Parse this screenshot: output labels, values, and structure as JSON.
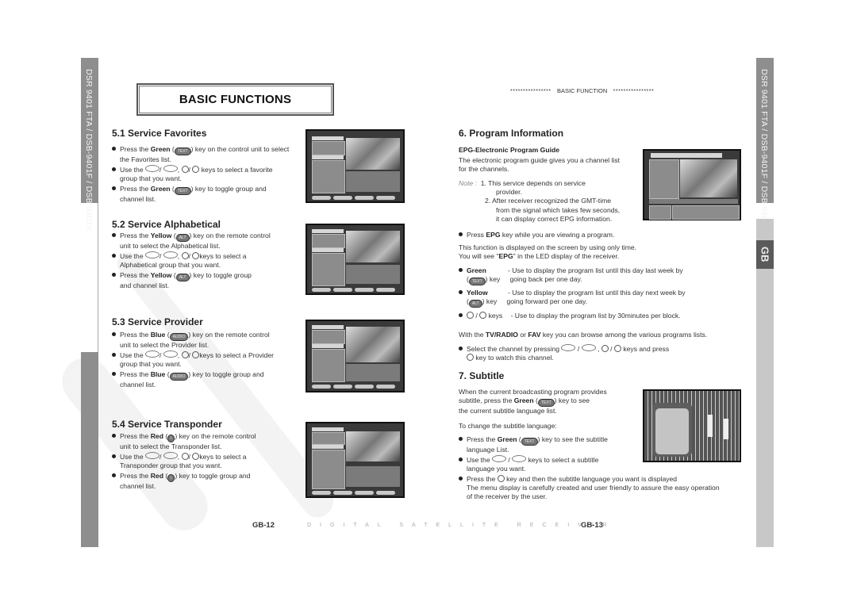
{
  "sidebar": {
    "model_text": "DSR 9401 FTA / DSB-9401F / DSB-9401V",
    "language_tab": "GB"
  },
  "page_title": "BASIC FUNCTIONS",
  "running_header": {
    "stars_left": "****************",
    "label": "BASIC FUNCTION",
    "stars_right": "****************"
  },
  "left_page": {
    "sections": [
      {
        "heading": "5.1 Service Favorites",
        "bullets": [
          {
            "pre": "Press the ",
            "color": "Green",
            "key": "TEXT",
            "post": " key on the control unit to select",
            "cont": "the Favorites list."
          },
          {
            "pre": "Use the ",
            "post": " keys to select a favorite",
            "cont": "group that you want."
          },
          {
            "pre": "Press the ",
            "color": "Green",
            "key": "TEXT",
            "post": " key to toggle group and",
            "cont": "channel list."
          }
        ]
      },
      {
        "heading": "5.2 Service Alphabetical",
        "bullets": [
          {
            "pre": "Press the ",
            "color": "Yellow",
            "key": "ALT",
            "post": " key on the remote control",
            "cont": "unit to select the Alphabetical list."
          },
          {
            "pre": "Use the ",
            "post": "keys to select a",
            "cont": "Alphabetical group that you want."
          },
          {
            "pre": "Press the ",
            "color": "Yellow",
            "key": "ALT",
            "post": " key to toggle group",
            "cont": "and channel list."
          }
        ]
      },
      {
        "heading": "5.3 Service Provider",
        "bullets": [
          {
            "pre": "Press the ",
            "color": "Blue",
            "key": "AUDIO",
            "post": " key on the remote control",
            "cont": "unit to select the Provider list."
          },
          {
            "pre": "Use the ",
            "post": "keys to select a Provider",
            "cont": "group that you want."
          },
          {
            "pre": "Press the ",
            "color": "Blue",
            "key": "AUDIO",
            "post": " key to toggle group and",
            "cont": "channel list."
          }
        ]
      },
      {
        "heading": "5.4 Service Transponder",
        "bullets": [
          {
            "pre": "Press the ",
            "color": "Red",
            "key": "i",
            "post": " key on the remote control",
            "cont": "unit to select the Transponder list."
          },
          {
            "pre": "Use the ",
            "post": "keys to select a",
            "cont": "Transponder group that you want."
          },
          {
            "pre": "Press the ",
            "color": "Red",
            "key": "i",
            "post": " key to toggle group and",
            "cont": "channel list."
          }
        ]
      }
    ]
  },
  "right_page": {
    "program_info": {
      "heading": "6. Program Information",
      "subheading": "EPG-Electronic Program Guide",
      "intro_1": "The electronic program guide gives you a channel list",
      "intro_2": "for the channels.",
      "note_label": "Note :",
      "note_1a": "1.  This service depends on service",
      "note_1b": "provider.",
      "note_2a": "2.  After receiver recognized the GMT-time",
      "note_2b": "from the signal which takes few seconds,",
      "note_2c": "it can display correct EPG information.",
      "press_pre": "Press ",
      "press_key": "EPG",
      "press_post": " key while you are viewing a program.",
      "func_1": "This function is displayed on the screen by using only time.",
      "func_2a": "You will see \"",
      "func_2b": "EPG",
      "func_2c": "\" in the LED display of the receiver.",
      "keys": [
        {
          "name": "Green",
          "key": "TEXT",
          "suffix": ") key",
          "desc1": "- Use to display the program list until this day last week by",
          "desc2": "going back per one day."
        },
        {
          "name": "Yellow",
          "key": "ALT",
          "suffix": ") key",
          "desc1": "- Use to display the program list until this day next week by",
          "desc2": "going forward per one day."
        }
      ],
      "updown_label": "keys",
      "updown_desc": "- Use to display the program list by 30minutes per block.",
      "browse_pre": "With the ",
      "browse_k1": "TV/RADIO",
      "browse_mid": " or ",
      "browse_k2": "FAV",
      "browse_post": " key you can browse among the various programs lists.",
      "select_pre": "Select the channel by pressing ",
      "select_post": " keys and press",
      "select_cont": " key to watch this channel."
    },
    "subtitle": {
      "heading": "7. Subtitle",
      "p1": "When the current broadcasting program provides",
      "p2a": "subtitle, press the ",
      "p2b": "Green",
      "p2key": "TEXT",
      "p2c": " key to see",
      "p3": "the current subtitle language list.",
      "change": "To change the subtitle language:",
      "b1_pre": "Press the ",
      "b1_color": "Green",
      "b1_key": "TEXT",
      "b1_post": " key to see the subtitle",
      "b1_cont": "language List.",
      "b2_pre": "Use the ",
      "b2_post": " keys to select a subtitle",
      "b2_cont": "language you want.",
      "b3_pre": "Press the ",
      "b3_post": " key and then the subtitle language you want is displayed",
      "b3_cont1": "The menu display is carefully created and user friendly to assure the easy operation",
      "b3_cont2": "of the receiver by the user."
    }
  },
  "footer": {
    "left_page_num": "GB-12",
    "center": "DIGITAL SATELLITE RECEIVER",
    "right_page_num": "GB-13"
  }
}
